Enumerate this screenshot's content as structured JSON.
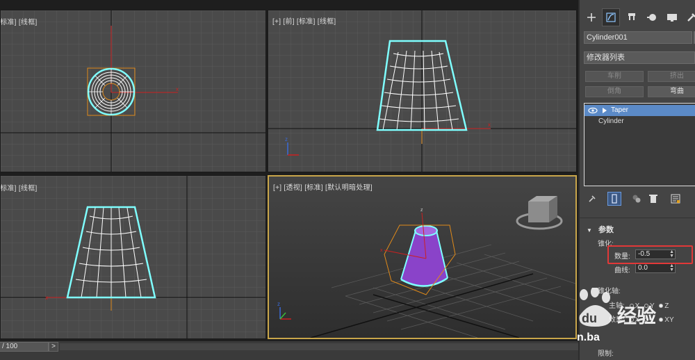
{
  "viewports": {
    "top_label": "[标准] [线框]",
    "front_label": "[+] [前] [标准] [线框]",
    "left_label": "[标准] [线框]",
    "persp_label": "[+] [透视] [标准] [默认明暗处理]"
  },
  "timeline": {
    "frame_display": "/ 100",
    "next_label": ">"
  },
  "command_panel": {
    "tabs": [
      "create-icon",
      "modify-icon",
      "hierarchy-icon",
      "motion-icon",
      "display-icon",
      "utilities-icon"
    ],
    "object_name": "Cylinder001",
    "modifier_list": "修改器列表",
    "quick_buttons": [
      "车削",
      "挤出",
      "倒角",
      "弯曲"
    ],
    "stack": [
      {
        "label": "Taper",
        "selected": true
      },
      {
        "label": "Cylinder",
        "selected": false
      }
    ],
    "params": {
      "rollout_title": "参数",
      "taper_group": "锥化:",
      "amount_label": "数量:",
      "amount_value": "-0.5",
      "curve_label": "曲线:",
      "curve_value": "0.0",
      "axis_group": "锥化轴:",
      "primary_label": "主轴:",
      "effect_label": "效果:",
      "primary_options": [
        "X",
        "Y",
        "Z"
      ],
      "effect_options": [
        "X",
        "Y",
        "XY"
      ],
      "limit_label": "限制:"
    }
  },
  "watermark": {
    "brand": "经验",
    "prefix": "du",
    "domain": "n.ba"
  },
  "colors": {
    "selection": "#7fffff",
    "accent_red": "#e23838",
    "cone_purple": "#8a43c9",
    "viewport_active": "#c9a64a"
  }
}
